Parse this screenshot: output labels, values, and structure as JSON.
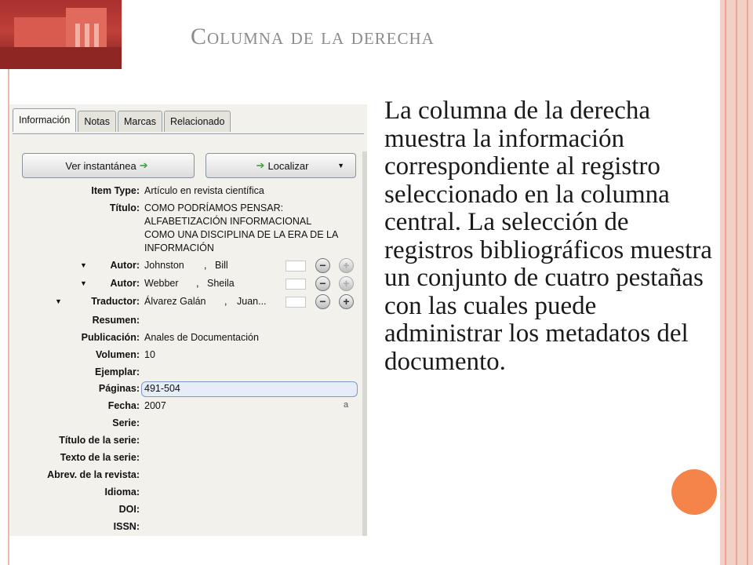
{
  "slide": {
    "title": "Columna de la derecha",
    "body": "La columna de la derecha muestra la información correspondiente al registro seleccionado en la columna central. La selección de registros bibliográficos muestra un conjunto de cuatro pestañas con las cuales puede administrar los metadatos del documento.",
    "accent_color": "#f5844a"
  },
  "panel": {
    "tabs": [
      "Información",
      "Notas",
      "Marcas",
      "Relacionado"
    ],
    "active_tab": "Información",
    "snapshot_button": "Ver instantánea",
    "locate_button": "Localizar",
    "fields": [
      {
        "label": "Item Type:",
        "value": "Artículo en revista científica"
      },
      {
        "label": "Título:",
        "value_lines": [
          "COMO PODRÍAMOS PENSAR:",
          "ALFABETIZACIÓN INFORMACIONAL",
          "COMO UNA DISCIPLINA DE LA ERA DE LA",
          "INFORMACIÓN"
        ]
      },
      {
        "label": "Autor:",
        "last": "Johnston",
        "first": "Bill"
      },
      {
        "label": "Autor:",
        "last": "Webber",
        "first": "Sheila"
      },
      {
        "label": "Traductor:",
        "last": "Álvarez Galán",
        "first": "Juan..."
      },
      {
        "label": "Resumen:",
        "value": ""
      },
      {
        "label": "Publicación:",
        "value": "Anales de Documentación"
      },
      {
        "label": "Volumen:",
        "value": "10"
      },
      {
        "label": "Ejemplar:",
        "value": ""
      },
      {
        "label": "Páginas:",
        "value": "491-504"
      },
      {
        "label": "Fecha:",
        "value": "2007",
        "marker": "a"
      },
      {
        "label": "Serie:",
        "value": ""
      },
      {
        "label": "Título de la serie:",
        "value": ""
      },
      {
        "label": "Texto de la serie:",
        "value": ""
      },
      {
        "label": "Abrev. de la revista:",
        "value": ""
      },
      {
        "label": "Idioma:",
        "value": ""
      },
      {
        "label": "DOI:",
        "value": ""
      },
      {
        "label": "ISSN:",
        "value": ""
      }
    ],
    "separator": ",",
    "icons": {
      "expand": "triangle-down-icon",
      "remove": "minus-circle-icon",
      "add": "plus-circle-icon",
      "arrow": "green-arrow-icon"
    }
  }
}
